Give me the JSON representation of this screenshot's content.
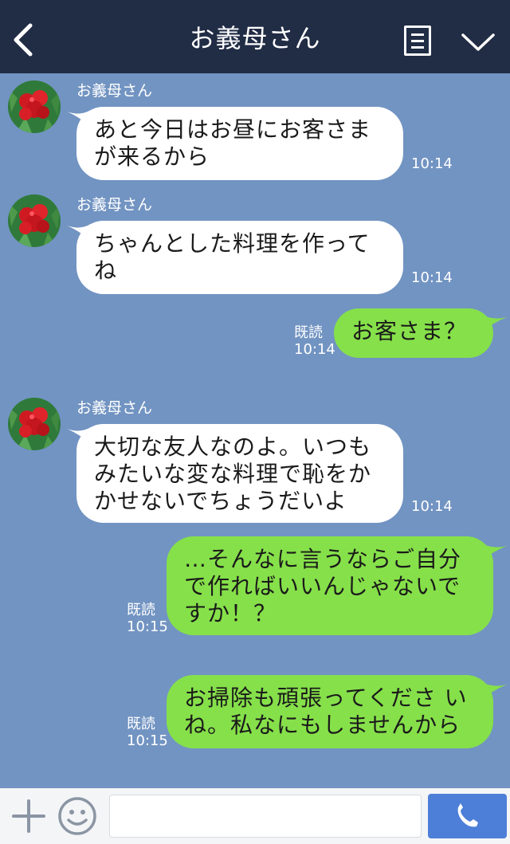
{
  "header": {
    "title": "お義母さん"
  },
  "messages": [
    {
      "sender": "お義母さん",
      "text": "あと今日はお昼にお客さま\nが来るから",
      "time": "10:14"
    },
    {
      "sender": "お義母さん",
      "text": "ちゃんとした料理を作って\nね",
      "time": "10:14"
    },
    {
      "read": "既読",
      "text": "お客さま？",
      "time": "10:14"
    },
    {
      "sender": "お義母さん",
      "text": "大切な友人なのよ。いつも\nみたいな変な料理で恥をか\nかせないでちょうだいよ",
      "time": "10:14"
    },
    {
      "read": "既読",
      "text": "…そんなに言うならご自分\nで作ればいいんじゃないで\nすか！？",
      "time": "10:15"
    },
    {
      "read": "既読",
      "text": "お掃除も頑張ってくださ い\nね。私なにもしませんから",
      "time": "10:15"
    }
  ],
  "colors": {
    "background": "#7294c2",
    "header": "#212c45",
    "incoming_bubble": "#ffffff",
    "outgoing_bubble": "#86e04a",
    "call_button": "#4d7fd8"
  },
  "icons": {
    "back": "chevron-left-icon",
    "menu": "document-menu-icon",
    "collapse": "chevron-down-icon",
    "add": "plus-icon",
    "emoji": "smiley-icon",
    "call": "phone-icon"
  },
  "footer": {
    "input_value": ""
  }
}
